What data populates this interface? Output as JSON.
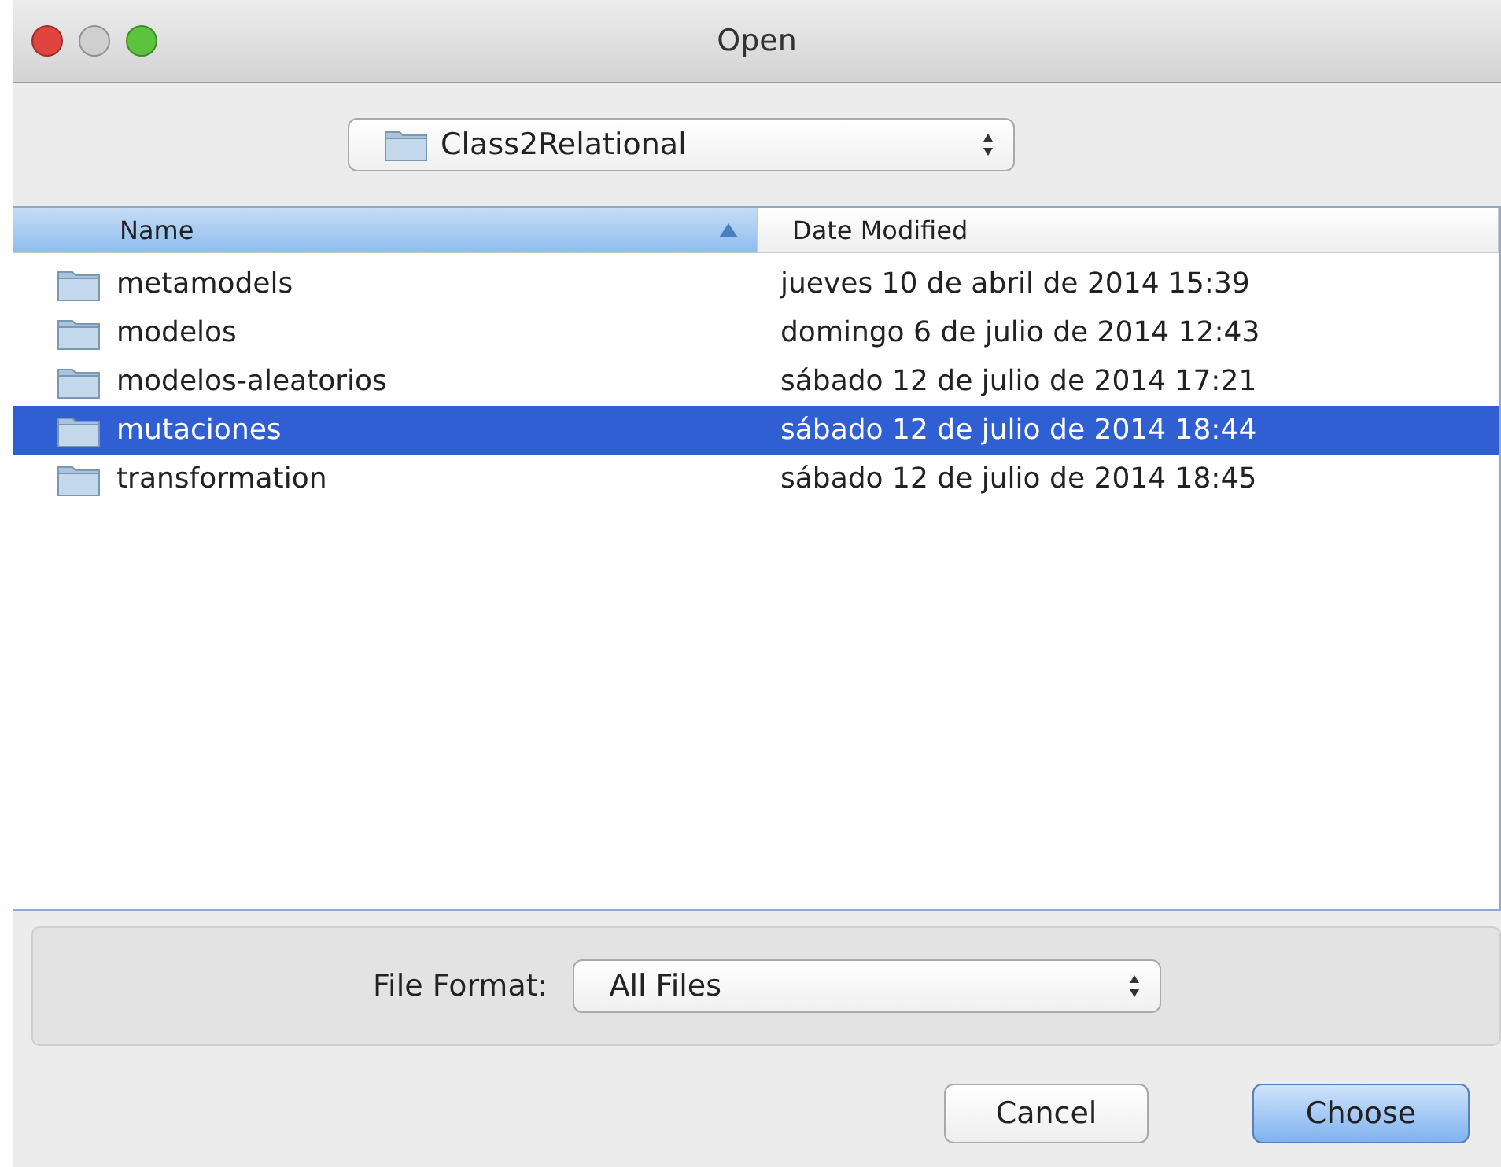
{
  "window": {
    "title": "Open"
  },
  "location": {
    "value": "Class2Relational"
  },
  "table": {
    "columns": [
      {
        "label": "Name",
        "sorted": true
      },
      {
        "label": "Date Modified",
        "sorted": false
      }
    ],
    "rows": [
      {
        "name": "metamodels",
        "date": "jueves 10 de abril de 2014 15:39",
        "selected": false
      },
      {
        "name": "modelos",
        "date": "domingo 6 de julio de 2014 12:43",
        "selected": false
      },
      {
        "name": "modelos-aleatorios",
        "date": "sábado 12 de julio de 2014 17:21",
        "selected": false
      },
      {
        "name": "mutaciones",
        "date": "sábado 12 de julio de 2014 18:44",
        "selected": true
      },
      {
        "name": "transformation",
        "date": "sábado 12 de julio de 2014 18:45",
        "selected": false
      }
    ]
  },
  "file_format": {
    "label": "File Format:",
    "value": "All Files"
  },
  "buttons": [
    {
      "label": "Cancel",
      "default": false
    },
    {
      "label": "Choose",
      "default": true
    }
  ]
}
